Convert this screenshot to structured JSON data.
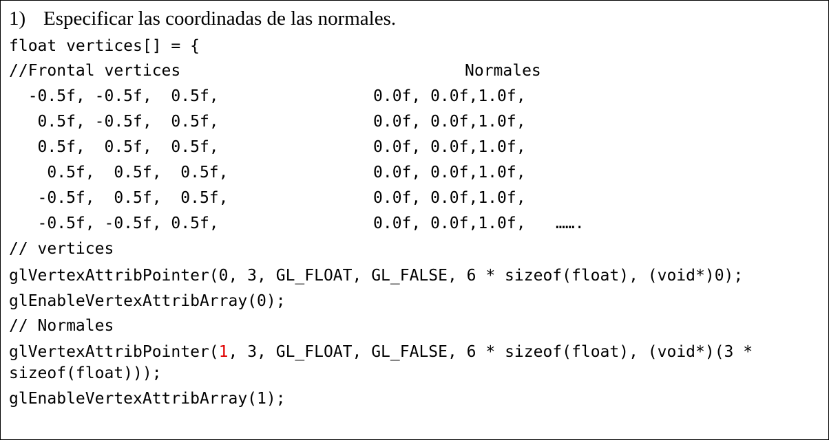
{
  "heading": {
    "number": "1)",
    "text": "Especificar las coordinadas de las normales."
  },
  "code": {
    "decl": "float vertices[] = {",
    "comment_frontal": "//Frontal vertices",
    "normales_header": "Normales",
    "rows": [
      {
        "vertex": "  -0.5f, -0.5f,  0.5f,",
        "normal": "0.0f, 0.0f,1.0f,"
      },
      {
        "vertex": "   0.5f, -0.5f,  0.5f,",
        "normal": "0.0f, 0.0f,1.0f,"
      },
      {
        "vertex": "   0.5f,  0.5f,  0.5f,",
        "normal": "0.0f, 0.0f,1.0f,"
      },
      {
        "vertex": "    0.5f,  0.5f,  0.5f,",
        "normal": "0.0f, 0.0f,1.0f,"
      },
      {
        "vertex": "   -0.5f,  0.5f,  0.5f,",
        "normal": "0.0f, 0.0f,1.0f,"
      },
      {
        "vertex": "   -0.5f, -0.5f, 0.5f,",
        "normal": "0.0f, 0.0f,1.0f,"
      }
    ],
    "ellipsis": "…….",
    "comment_vertices": "// vertices",
    "attrib0_line": "glVertexAttribPointer(0, 3, GL_FLOAT, GL_FALSE, 6 * sizeof(float), (void*)0);",
    "enable0_line": "glEnableVertexAttribArray(0);",
    "comment_normales": "// Normales",
    "attrib1_prefix": "glVertexAttribPointer(",
    "attrib1_index": "1",
    "attrib1_suffix": ", 3, GL_FLOAT, GL_FALSE, 6 * sizeof(float), (void*)(3 *",
    "attrib1_cont": "sizeof(float)));",
    "enable1_line": "glEnableVertexAttribArray(1);"
  },
  "colors": {
    "highlight": "#e00000",
    "border": "#000000"
  }
}
